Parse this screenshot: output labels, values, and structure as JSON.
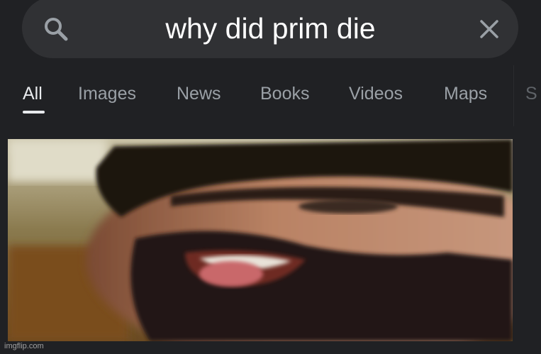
{
  "search": {
    "query": "why did prim die",
    "search_icon": "search-icon",
    "clear_icon": "close-icon"
  },
  "tabs": [
    {
      "label": "All",
      "active": true
    },
    {
      "label": "Images",
      "active": false
    },
    {
      "label": "News",
      "active": false
    },
    {
      "label": "Books",
      "active": false
    },
    {
      "label": "Videos",
      "active": false
    },
    {
      "label": "Maps",
      "active": false
    },
    {
      "label": "S",
      "active": false
    }
  ],
  "result_image": {
    "description_icon": "photo"
  },
  "watermark": "imgflip.com",
  "colors": {
    "background": "#202124",
    "search_box": "#303134",
    "active_tab": "#e8eaed",
    "inactive_tab": "#9aa0a6"
  }
}
